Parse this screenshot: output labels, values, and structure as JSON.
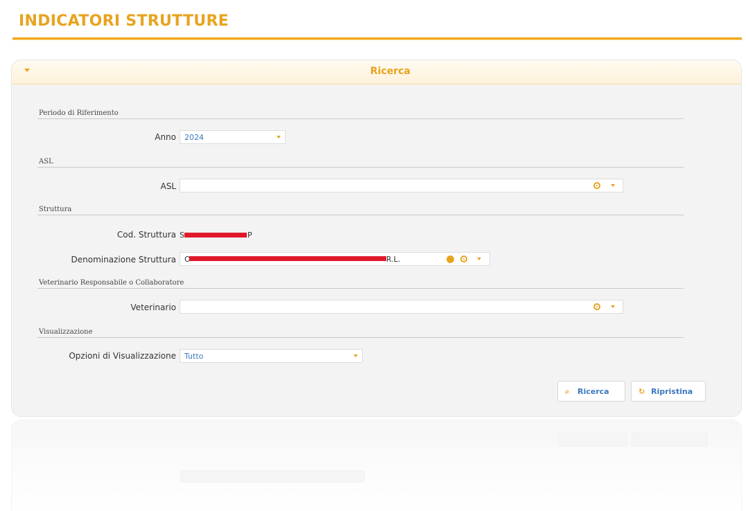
{
  "page": {
    "title": "INDICATORI STRUTTURE"
  },
  "panel": {
    "title": "Ricerca"
  },
  "sections": {
    "periodo": "Periodo di Riferimento",
    "asl": "ASL",
    "struttura": "Struttura",
    "veterinario": "Veterinario Responsabile o Collaboratore",
    "visualizzazione": "Visualizzazione"
  },
  "fields": {
    "anno": {
      "label": "Anno",
      "value": "2024"
    },
    "asl": {
      "label": "ASL",
      "value": ""
    },
    "cod_struttura": {
      "label": "Cod. Struttura",
      "prefix": "S",
      "suffix": "P"
    },
    "denominazione": {
      "label": "Denominazione Struttura",
      "prefix": "O",
      "suffix": "R.L."
    },
    "veterinario": {
      "label": "Veterinario",
      "value": ""
    },
    "opzioni": {
      "label": "Opzioni di Visualizzazione",
      "value": "Tutto"
    }
  },
  "buttons": {
    "ricerca": "Ricerca",
    "ripristina": "Ripristina"
  },
  "icons": {
    "toggle": "triangle-down-icon",
    "dropdown": "chevron-down-icon",
    "clear": "clear-circle-icon",
    "confirm": "check-circle-icon",
    "search": "search-icon",
    "reset": "reset-icon"
  },
  "colors": {
    "accent": "#e8a31f",
    "value_text": "#3a79c0",
    "redaction": "#e0182a"
  }
}
